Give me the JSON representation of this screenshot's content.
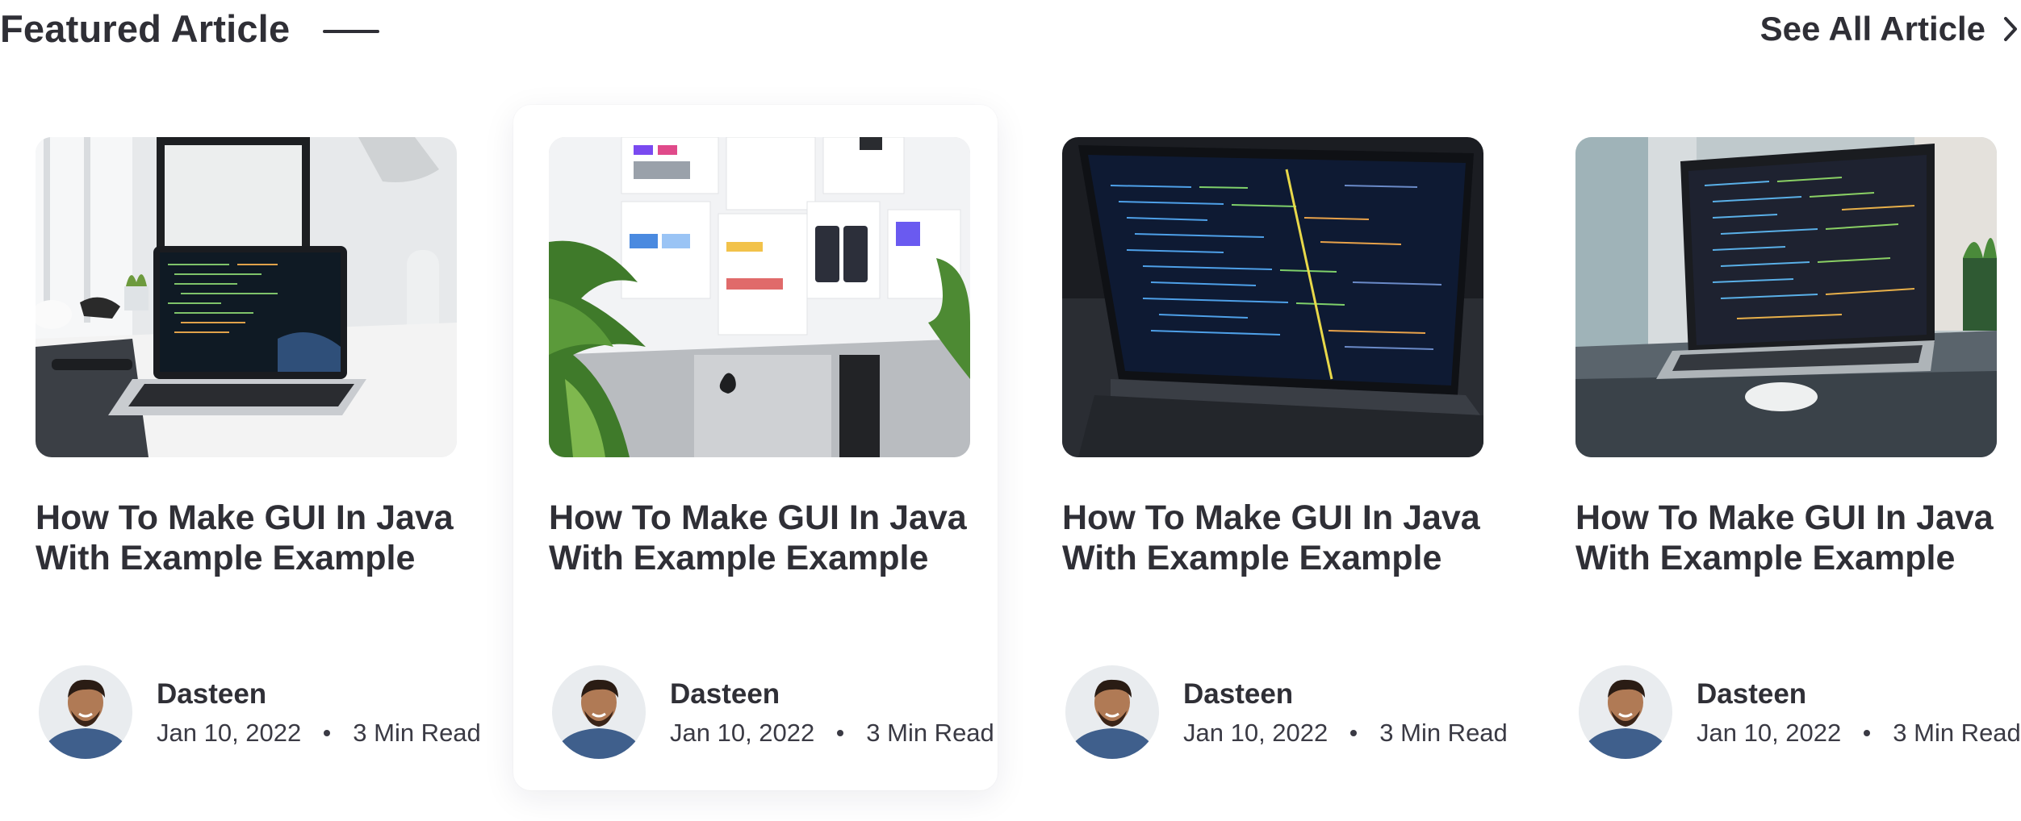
{
  "header": {
    "title": "Featured Article",
    "see_all_label": "See All Article",
    "see_all_icon": "chevron-right-icon"
  },
  "articles": [
    {
      "image": "desk-laptop-monitor-photo",
      "title": "How To Make GUI In Java With Example Example",
      "author": "Dasteen",
      "date": "Jan 10, 2022",
      "read_time": "3 Min Read",
      "highlighted": false
    },
    {
      "image": "imac-widget-templates-photo",
      "title": "How To Make GUI In Java With Example Example",
      "author": "Dasteen",
      "date": "Jan 10, 2022",
      "read_time": "3 Min Read",
      "highlighted": true
    },
    {
      "image": "dark-laptop-code-photo",
      "title": "How To Make GUI In Java With Example Example",
      "author": "Dasteen",
      "date": "Jan 10, 2022",
      "read_time": "3 Min Read",
      "highlighted": false
    },
    {
      "image": "laptop-code-window-photo",
      "title": "How To Make GUI In Java With Example Example",
      "author": "Dasteen",
      "date": "Jan 10, 2022",
      "read_time": "3 Min Read",
      "highlighted": false
    }
  ],
  "colors": {
    "text": "#2f2f36",
    "background": "#ffffff"
  }
}
